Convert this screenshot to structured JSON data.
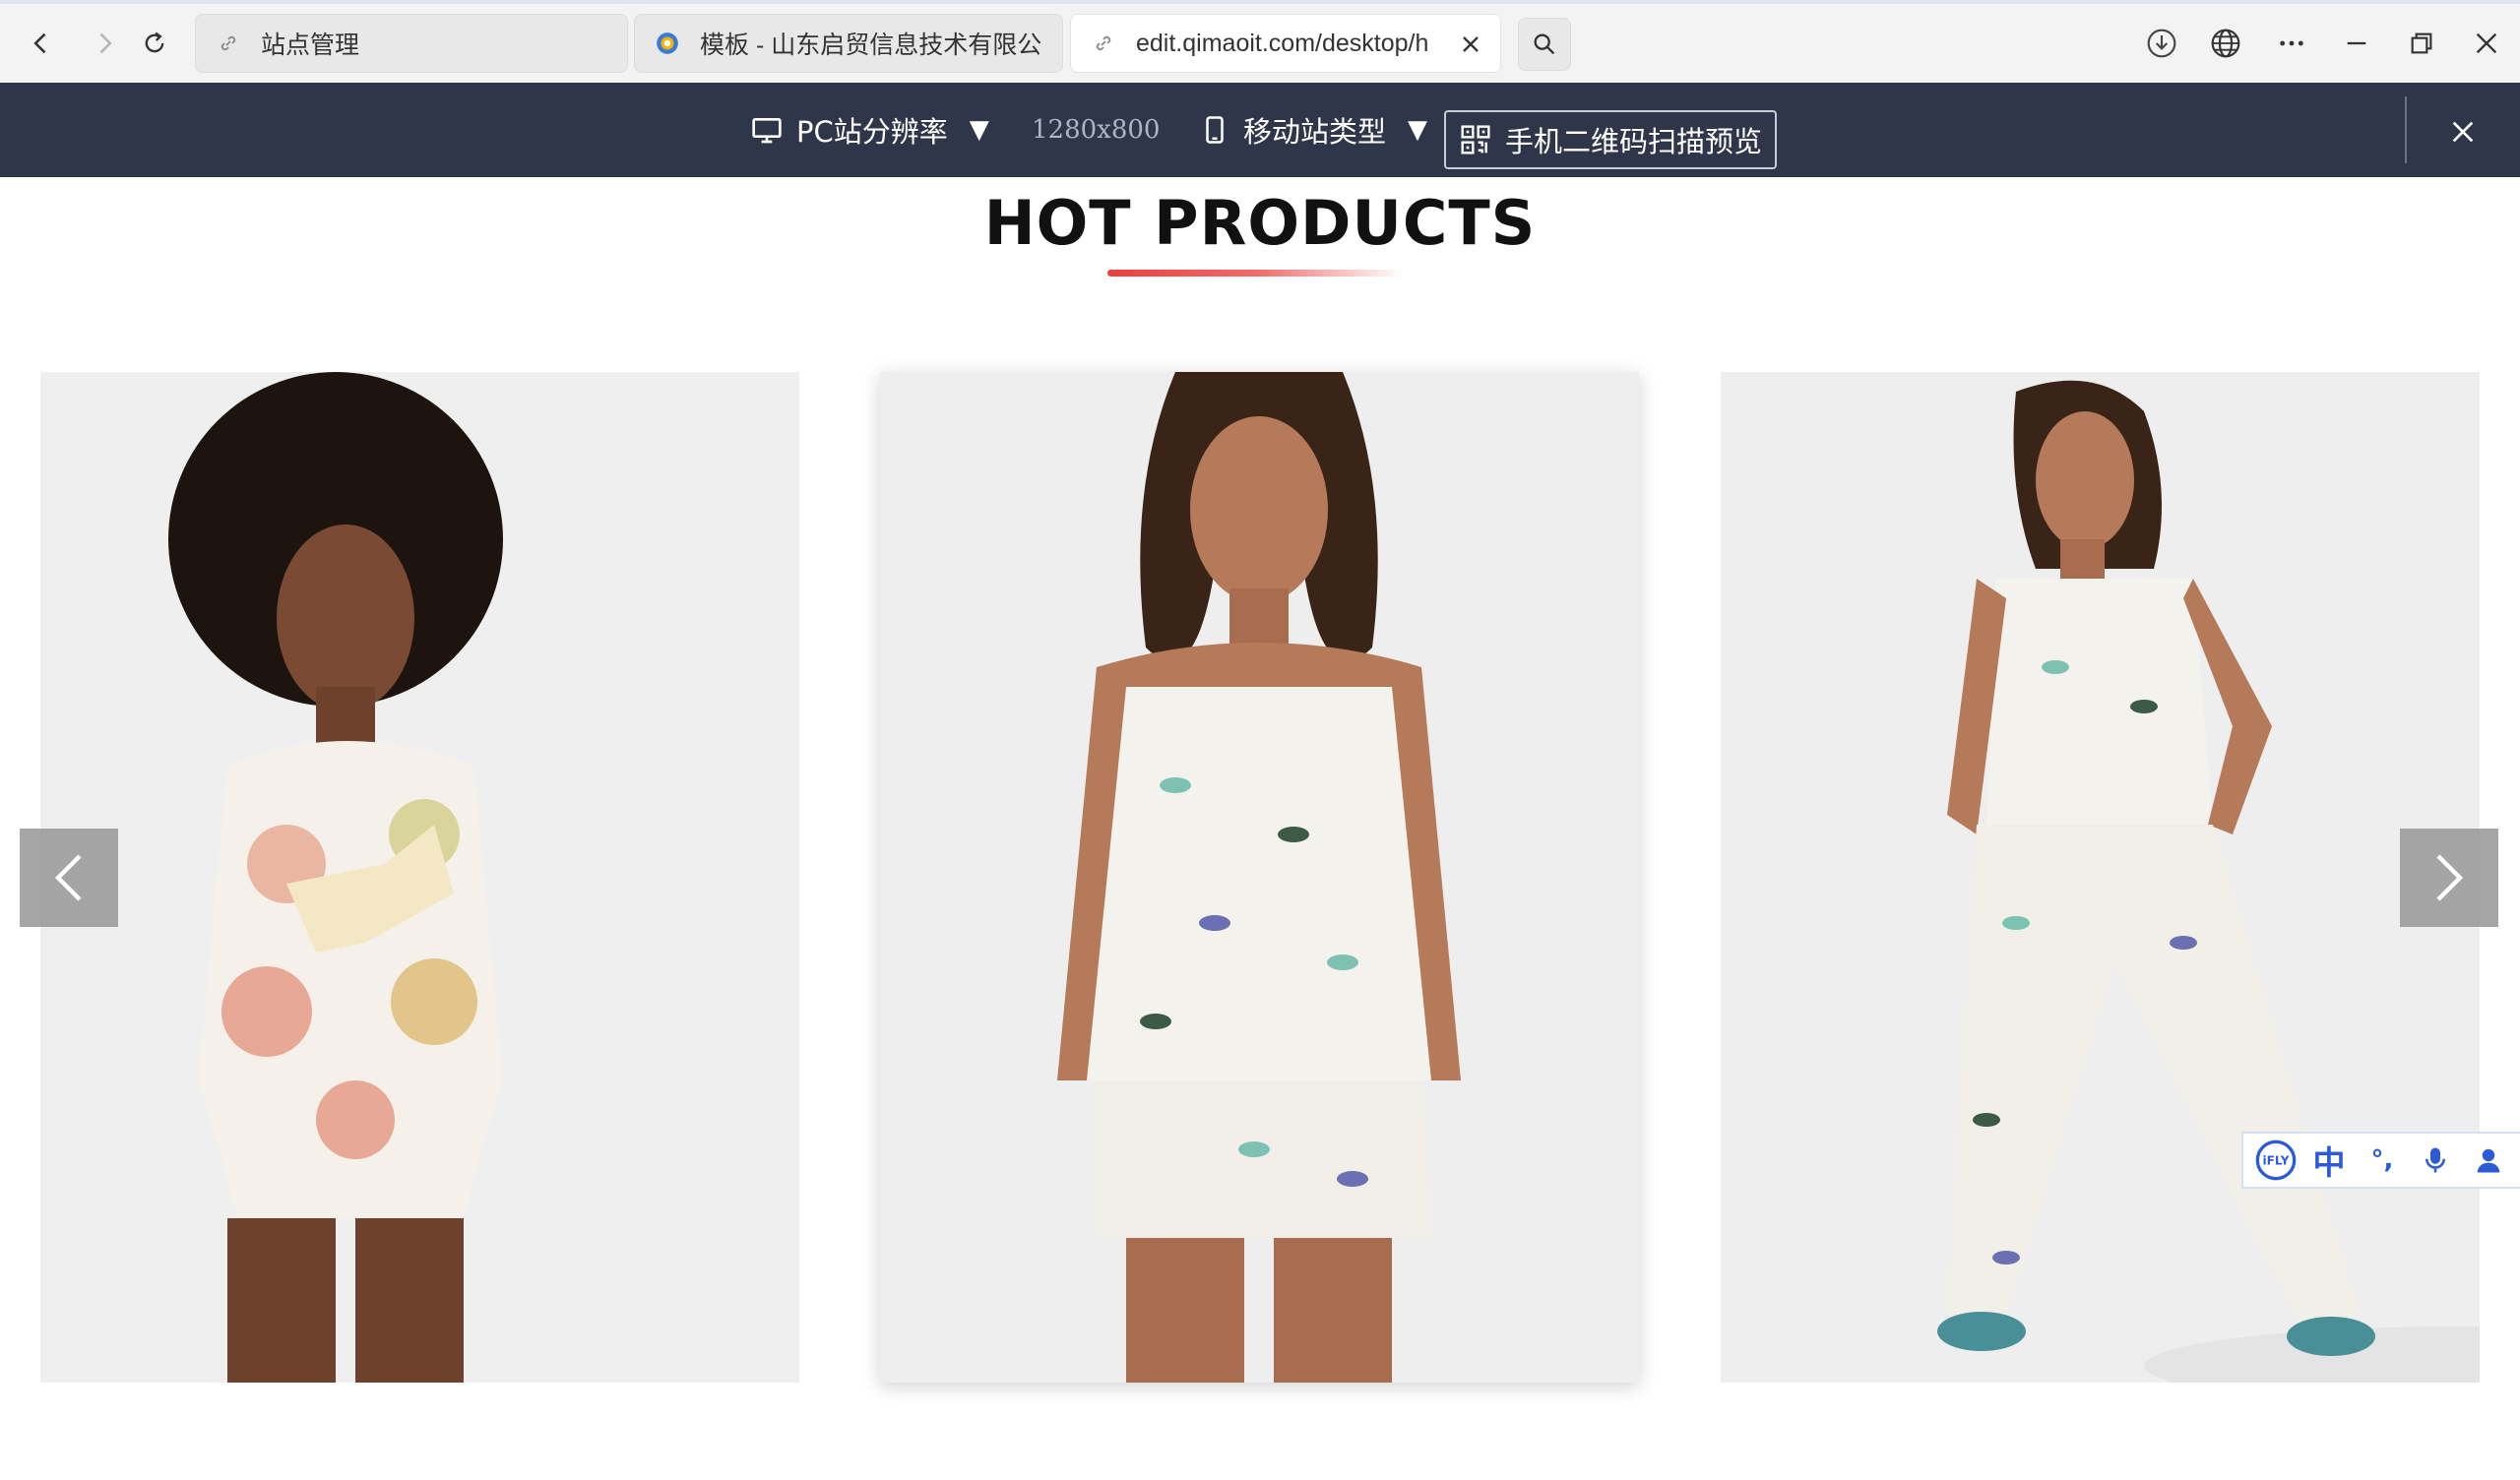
{
  "browser": {
    "tabs": [
      {
        "label": "站点管理",
        "icon": "link-icon",
        "state": "inactive"
      },
      {
        "label": "模板 - 山东启贸信息技术有限公司",
        "icon": "site-favicon",
        "state": "inactive"
      },
      {
        "label": "edit.qimaoit.com/desktop/h",
        "icon": "link-icon",
        "state": "active"
      }
    ]
  },
  "preview_toolbar": {
    "pc_resolution_label": "PC站分辨率",
    "pc_resolution_value": "1280x800",
    "mobile_type_label": "移动站类型",
    "qr_preview_label": "手机二维码扫描预览",
    "dropdown_glyph": "▼"
  },
  "section": {
    "title": "HOT PRODUCTS",
    "accent_color": "#e8413f"
  },
  "products": [
    {
      "image": "woman-in-world-map-print-pajama-reading-book"
    },
    {
      "image": "woman-in-floral-cami-and-shorts-set"
    },
    {
      "image": "woman-in-floral-cami-and-pants-set"
    }
  ],
  "ime": {
    "logo": "iFLY",
    "mode": "中",
    "punct": "°,"
  }
}
